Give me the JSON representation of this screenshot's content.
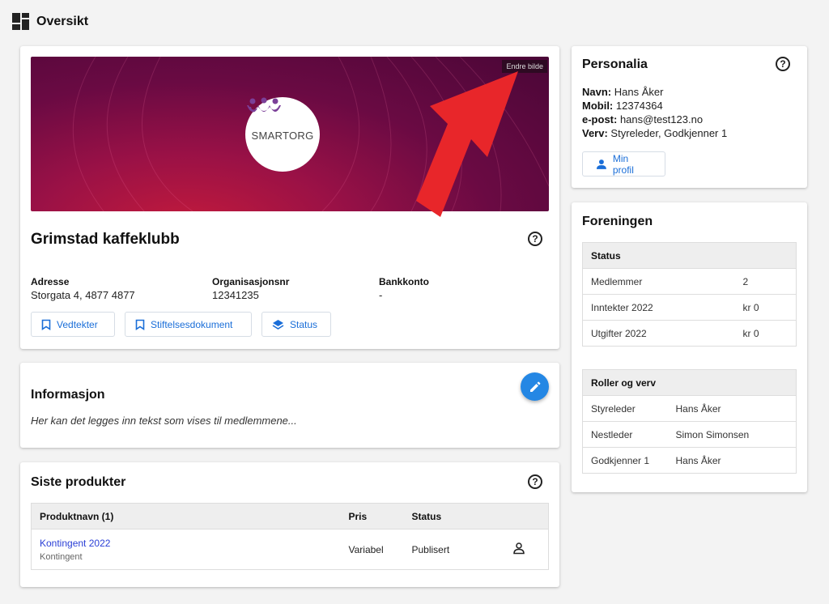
{
  "header": {
    "title": "Oversikt",
    "icon": "dashboard-icon"
  },
  "org": {
    "change_image_label": "Endre bilde",
    "logo_text": "SMARTORG",
    "name": "Grimstad kaffeklubb",
    "address_label": "Adresse",
    "address_value": "Storgata 4, 4877 4877",
    "orgnr_label": "Organisasjonsnr",
    "orgnr_value": "12341235",
    "bank_label": "Bankkonto",
    "bank_value": "-",
    "buttons": [
      {
        "label": "Vedtekter",
        "icon": "bookmark-icon"
      },
      {
        "label": "Stiftelsesdokument",
        "icon": "bookmark-icon"
      },
      {
        "label": "Status",
        "icon": "layers-icon"
      }
    ]
  },
  "info": {
    "title": "Informasjon",
    "text": "Her kan det legges inn tekst som vises til medlemmene...",
    "edit_icon": "pencil-icon"
  },
  "products": {
    "title": "Siste produkter",
    "columns": [
      "Produktnavn (1)",
      "Pris",
      "Status",
      ""
    ],
    "rows": [
      {
        "name": "Kontingent 2022",
        "type": "Kontingent",
        "price": "Variabel",
        "status": "Publisert",
        "icon": "person-icon"
      }
    ]
  },
  "personalia": {
    "title": "Personalia",
    "lines": [
      {
        "label": "Navn:",
        "value": " Hans Åker"
      },
      {
        "label": "Mobil:",
        "value": " 12374364"
      },
      {
        "label": "e-post:",
        "value": " hans@test123.no"
      },
      {
        "label": "Verv:",
        "value": "  Styreleder, Godkjenner 1"
      }
    ],
    "profile_button": "Min profil"
  },
  "foreningen": {
    "title": "Foreningen",
    "status_header": "Status",
    "status_rows": [
      {
        "label": "Medlemmer",
        "value": "2"
      },
      {
        "label": "Inntekter 2022",
        "value": "kr 0"
      },
      {
        "label": "Utgifter 2022",
        "value": "kr 0"
      }
    ],
    "roles_header": "Roller og verv",
    "role_rows": [
      {
        "role": "Styreleder",
        "name": "Hans Åker"
      },
      {
        "role": "Nestleder",
        "name": "Simon Simonsen"
      },
      {
        "role": "Godkjenner 1",
        "name": "Hans Åker"
      }
    ]
  },
  "colors": {
    "accent": "#1a6ed8",
    "fab": "#2487e4",
    "arrow": "#e8262a",
    "banner": "#7a0c42"
  }
}
